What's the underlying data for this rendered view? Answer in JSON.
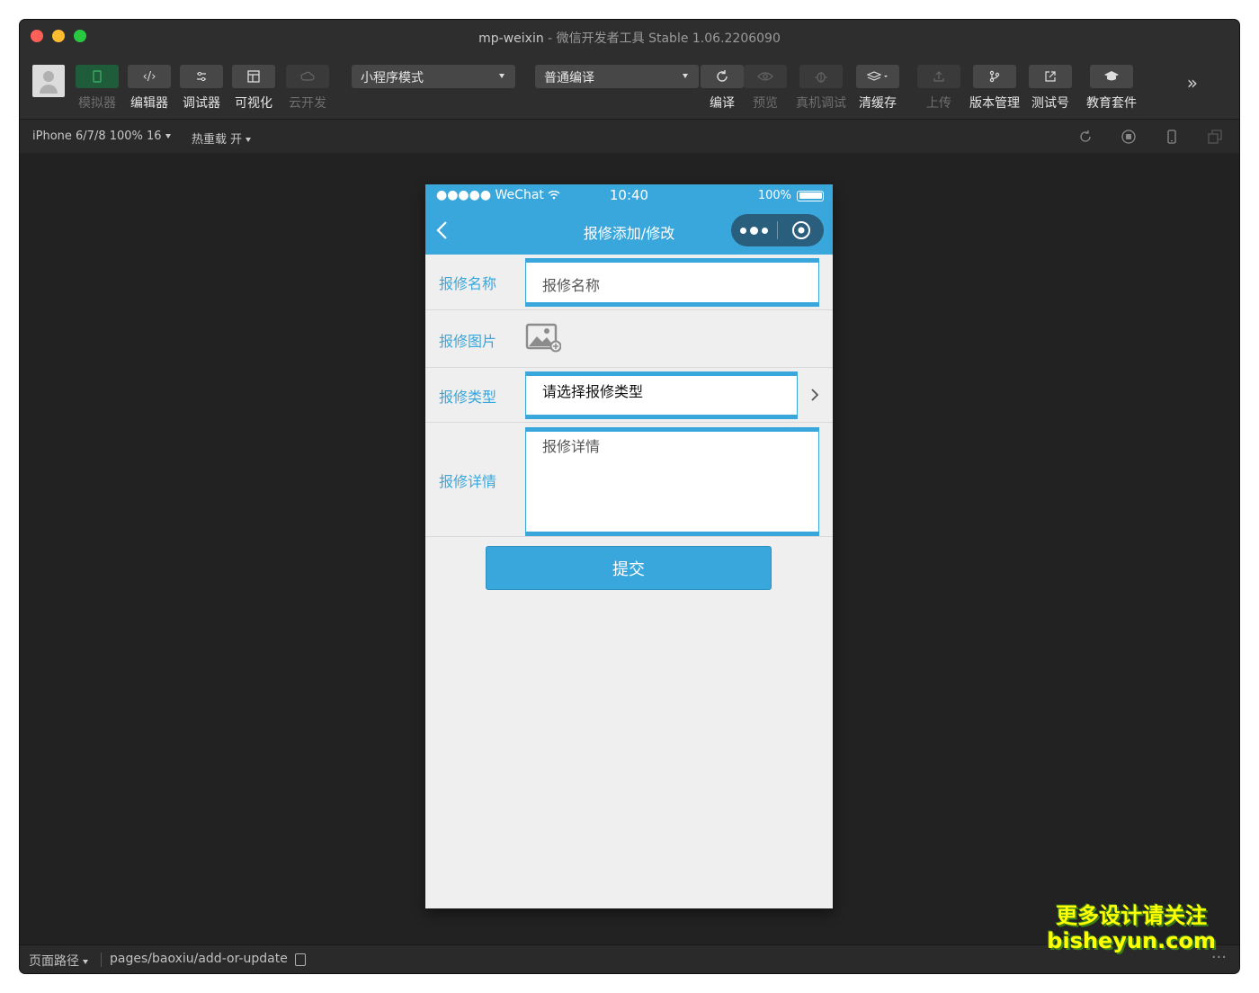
{
  "window": {
    "app_name": "mp-weixin",
    "separator": " - ",
    "subtitle": "微信开发者工具 Stable 1.06.2206090"
  },
  "toolbar": {
    "buttons_left": [
      {
        "label": "模拟器",
        "icon": "phone-icon",
        "state": "active"
      },
      {
        "label": "编辑器",
        "icon": "code-icon",
        "state": "normal"
      },
      {
        "label": "调试器",
        "icon": "debug-icon",
        "state": "normal"
      },
      {
        "label": "可视化",
        "icon": "layout-icon",
        "state": "normal"
      },
      {
        "label": "云开发",
        "icon": "cloud-icon",
        "state": "disabled"
      }
    ],
    "mode_select": "小程序模式",
    "compile_select": "普通编译",
    "buttons_right": [
      {
        "label": "编译",
        "icon": "refresh-icon",
        "state": "normal"
      },
      {
        "label": "预览",
        "icon": "eye-icon",
        "state": "disabled"
      },
      {
        "label": "真机调试",
        "icon": "bug-icon",
        "state": "disabled"
      },
      {
        "label": "清缓存",
        "icon": "layers-icon",
        "state": "normal"
      },
      {
        "label": "上传",
        "icon": "upload-icon",
        "state": "disabled"
      },
      {
        "label": "版本管理",
        "icon": "branch-icon",
        "state": "normal"
      },
      {
        "label": "测试号",
        "icon": "external-icon",
        "state": "normal"
      },
      {
        "label": "教育套件",
        "icon": "graduation-icon",
        "state": "normal"
      }
    ],
    "more_glyph": "»"
  },
  "subbar": {
    "device": "iPhone 6/7/8 100% 16",
    "hot_reload": "热重载 开"
  },
  "phone": {
    "status": {
      "carrier": "●●●●● WeChat",
      "time": "10:40",
      "battery": "100%"
    },
    "nav_title": "报修添加/修改",
    "form": {
      "name_label": "报修名称",
      "name_placeholder": "报修名称",
      "image_label": "报修图片",
      "type_label": "报修类型",
      "type_value": "请选择报修类型",
      "detail_label": "报修详情",
      "detail_placeholder": "报修详情",
      "submit_label": "提交"
    }
  },
  "footer": {
    "page_path_label": "页面路径",
    "page_path": "pages/baoxiu/add-or-update",
    "ellipsis": "···"
  },
  "watermark": {
    "line1": "更多设计请关注",
    "line2": "bisheyun.com"
  },
  "colors": {
    "accent": "#3aa7dc",
    "window_bg": "#222222",
    "toolbar_bg": "#2e2e2e",
    "active_green": "#3aa865"
  }
}
